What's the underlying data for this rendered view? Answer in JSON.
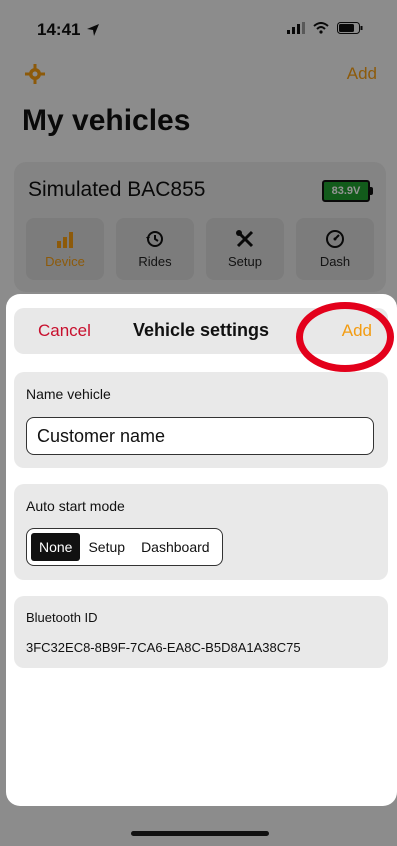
{
  "status_bar": {
    "time": "14:41"
  },
  "background": {
    "nav_add": "Add",
    "title": "My vehicles",
    "vehicle": {
      "name": "Simulated BAC855",
      "battery": "83.9V",
      "tiles": [
        {
          "label": "Device",
          "icon": "bar-chart-icon",
          "active": true
        },
        {
          "label": "Rides",
          "icon": "history-icon",
          "active": false
        },
        {
          "label": "Setup",
          "icon": "tools-icon",
          "active": false
        },
        {
          "label": "Dash",
          "icon": "gauge-icon",
          "active": false
        }
      ]
    }
  },
  "sheet": {
    "cancel_label": "Cancel",
    "title": "Vehicle settings",
    "add_label": "Add",
    "name_section": {
      "label": "Name vehicle",
      "value": "Customer name"
    },
    "auto_start": {
      "label": "Auto start mode",
      "options": [
        "None",
        "Setup",
        "Dashboard"
      ],
      "selected": "None"
    },
    "bluetooth": {
      "label": "Bluetooth ID",
      "value": "3FC32EC8-8B9F-7CA6-EA8C-B5D8A1A38C75"
    }
  },
  "colors": {
    "accent": "#f39c12",
    "cancel": "#c8102e",
    "highlight": "#e3001b",
    "battery": "#1f9d2f"
  }
}
